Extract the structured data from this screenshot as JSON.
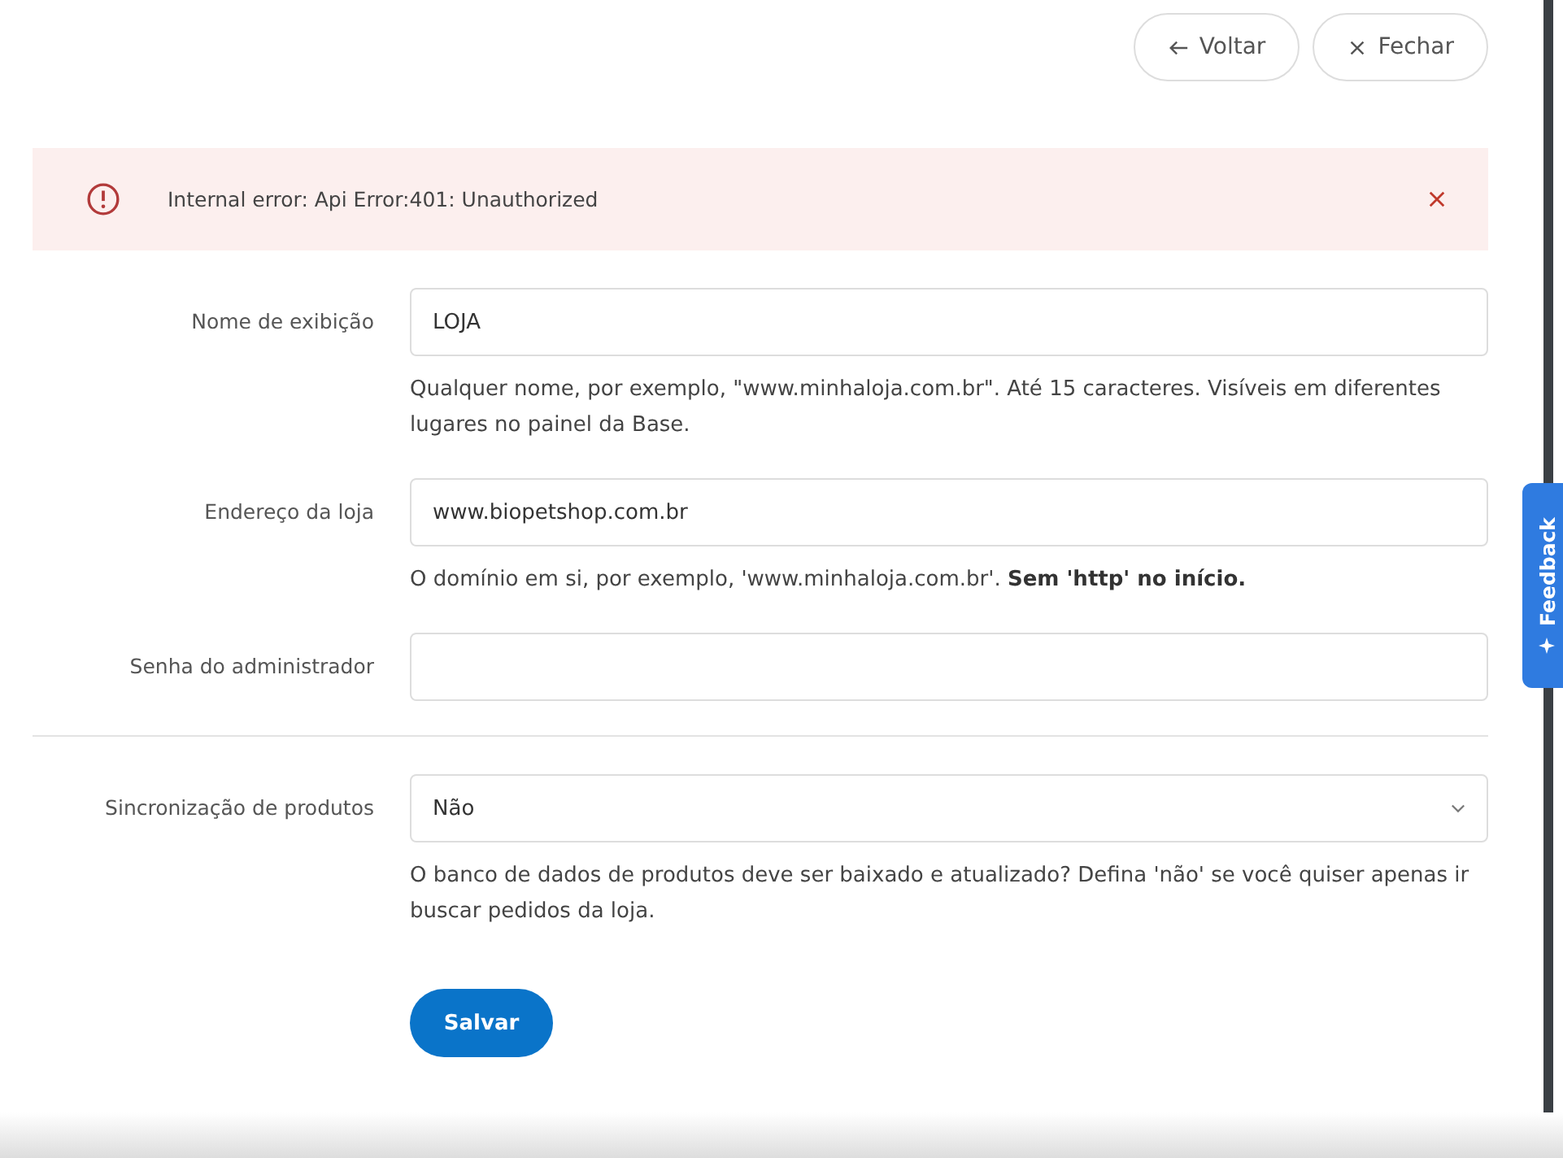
{
  "header_buttons": [
    {
      "kind": "back",
      "label": "Voltar"
    },
    {
      "kind": "close",
      "label": "Fechar"
    }
  ],
  "alert": {
    "message": "Internal error: Api Error:401: Unauthorized"
  },
  "fields": [
    {
      "kind": "text",
      "label": "Nome de exibição",
      "value": "LOJA",
      "help": "Qualquer nome, por exemplo, \"www.minhaloja.com.br\". Até 15 caracteres. Visíveis em diferentes lugares no painel da Base."
    },
    {
      "kind": "text",
      "label": "Endereço da loja",
      "value": "www.biopetshop.com.br",
      "help": "O domínio em si, por exemplo, 'www.minhaloja.com.br'. **Sem 'http' no início.**"
    },
    {
      "kind": "password",
      "label": "Senha do administrador"
    },
    {
      "kind": "divider"
    },
    {
      "kind": "select",
      "label": "Sincronização de produtos",
      "value": "Não",
      "help": "O banco de dados de produtos deve ser baixado e atualizado? Defina 'não' se você quiser apenas ir buscar pedidos da loja."
    }
  ],
  "save_button": "Salvar",
  "feedback_tab": "Feedback"
}
